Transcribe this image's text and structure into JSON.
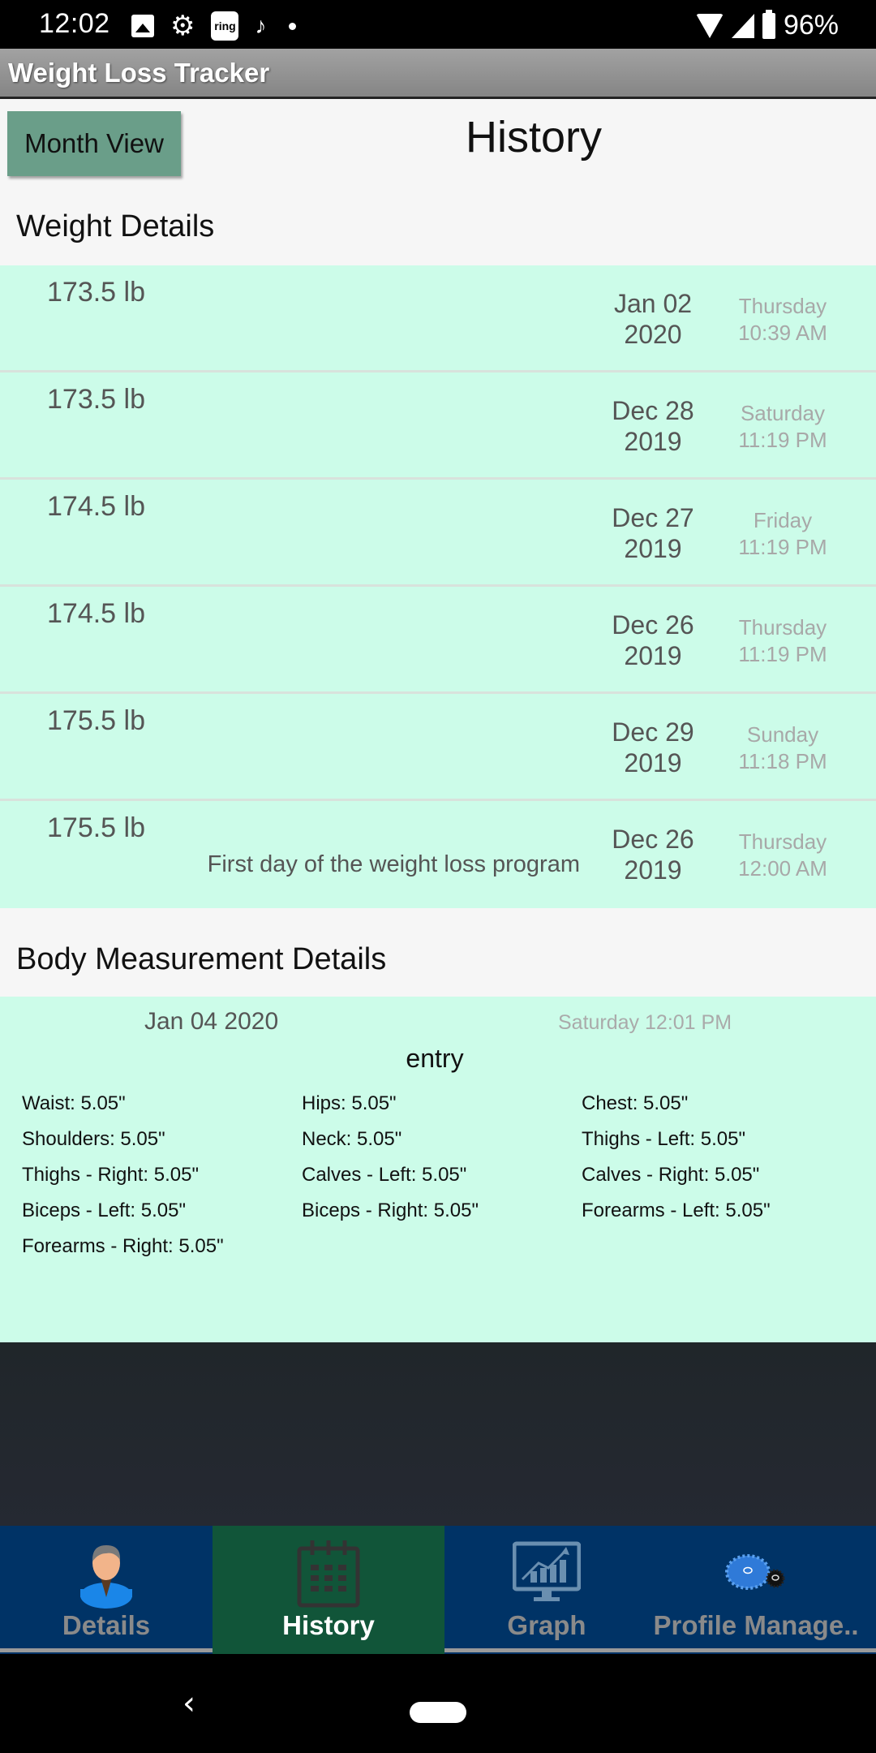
{
  "status_bar": {
    "time": "12:02",
    "left_icons": [
      "photo-icon",
      "settings-gear-icon",
      "ring-app-icon",
      "tiktok-icon",
      "notification-dot-icon"
    ],
    "right_icons": [
      "wifi-icon",
      "cell-signal-icon",
      "battery-icon"
    ],
    "ring_label": "ring",
    "battery_percent": "96%"
  },
  "app_bar": {
    "title": "Weight Loss Tracker"
  },
  "header": {
    "month_view_label": "Month View",
    "page_title": "History"
  },
  "weight_section": {
    "title": "Weight Details",
    "entries": [
      {
        "weight": "173.5 lb",
        "note": "",
        "date": "Jan 02",
        "year": "2020",
        "weekday": "Thursday",
        "time": "10:39 AM"
      },
      {
        "weight": "173.5 lb",
        "note": "",
        "date": "Dec 28",
        "year": "2019",
        "weekday": "Saturday",
        "time": "11:19 PM"
      },
      {
        "weight": "174.5 lb",
        "note": "",
        "date": "Dec 27",
        "year": "2019",
        "weekday": "Friday",
        "time": "11:19 PM"
      },
      {
        "weight": "174.5 lb",
        "note": "",
        "date": "Dec 26",
        "year": "2019",
        "weekday": "Thursday",
        "time": "11:19 PM"
      },
      {
        "weight": "175.5 lb",
        "note": "",
        "date": "Dec 29",
        "year": "2019",
        "weekday": "Sunday",
        "time": "11:18 PM"
      },
      {
        "weight": "175.5 lb",
        "note": "First day of the weight loss program",
        "date": "Dec 26",
        "year": "2019",
        "weekday": "Thursday",
        "time": "12:00 AM"
      }
    ]
  },
  "body_section": {
    "title": "Body Measurement Details",
    "entry": {
      "date": "Jan 04 2020",
      "when": "Saturday 12:01 PM",
      "note": "entry",
      "measurements": [
        "Waist: 5.05\"",
        "Hips: 5.05\"",
        "Chest: 5.05\"",
        "Shoulders: 5.05\"",
        "Neck: 5.05\"",
        "Thighs - Left: 5.05\"",
        "Thighs - Right: 5.05\"",
        "Calves - Left: 5.05\"",
        "Calves - Right: 5.05\"",
        "Biceps - Left: 5.05\"",
        "Biceps - Right: 5.05\"",
        "Forearms - Left: 5.05\"",
        "Forearms - Right: 5.05\""
      ]
    }
  },
  "bottom_nav": {
    "active": "History",
    "tabs": [
      {
        "label": "Details",
        "icon": "person-icon"
      },
      {
        "label": "History",
        "icon": "calendar-icon"
      },
      {
        "label": "Graph",
        "icon": "chart-monitor-icon"
      },
      {
        "label": "Profile Manage..",
        "icon": "gears-icon"
      }
    ]
  },
  "colors": {
    "row_background": "#ccfce9",
    "button_background": "#6a9e89",
    "nav_background": "#003366",
    "nav_active_background": "#115539"
  }
}
